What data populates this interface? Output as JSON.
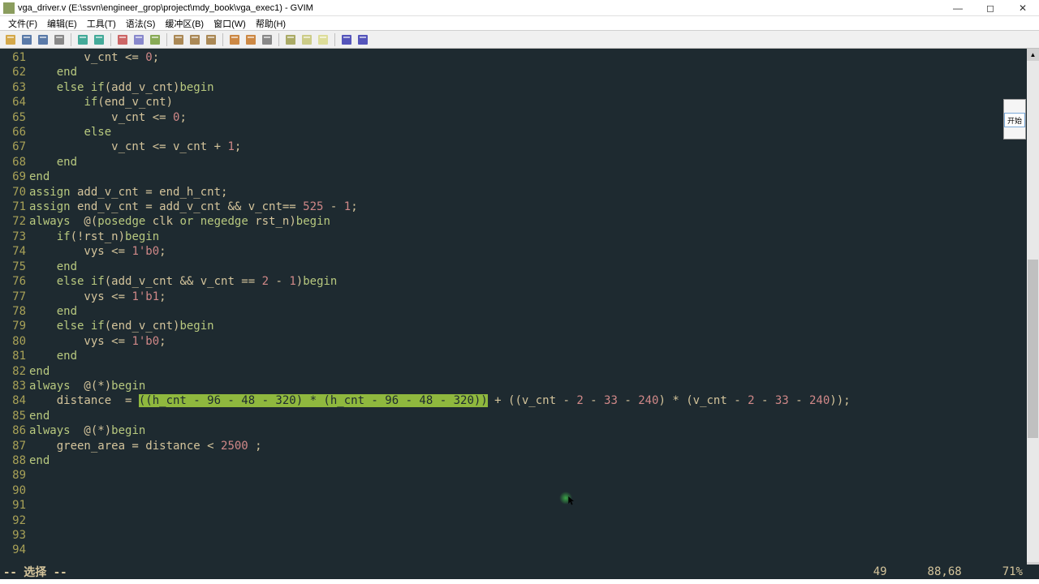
{
  "window": {
    "title": "vga_driver.v (E:\\ssvn\\engineer_grop\\project\\mdy_book\\vga_exec1) - GVIM"
  },
  "menus": [
    "文件(F)",
    "编辑(E)",
    "工具(T)",
    "语法(S)",
    "缓冲区(B)",
    "窗口(W)",
    "帮助(H)"
  ],
  "toolbar_icons": [
    "open-icon",
    "save-icon",
    "saveall-icon",
    "print-icon",
    "",
    "undo-icon",
    "redo-icon",
    "",
    "cut-icon",
    "copy-icon",
    "paste-icon",
    "",
    "find-prev-icon",
    "find-next-icon",
    "replace-icon",
    "",
    "run-icon",
    "make-icon",
    "shell-icon",
    "",
    "tag-icon",
    "tags-icon",
    "tagselect-icon",
    "",
    "help-icon",
    "findword-icon"
  ],
  "mini_window": {
    "btn": "开始"
  },
  "status": {
    "mode": "-- 选择 --",
    "col": "49",
    "pos": "88,68",
    "pct": "71%"
  },
  "first_line": 61,
  "lines": [
    {
      "n": 61,
      "segs": [
        {
          "t": "        v_cnt <= "
        },
        {
          "t": "0",
          "c": "num"
        },
        {
          "t": ";"
        }
      ]
    },
    {
      "n": 62,
      "segs": [
        {
          "t": "    "
        },
        {
          "t": "end",
          "c": "kw"
        }
      ]
    },
    {
      "n": 63,
      "segs": [
        {
          "t": "    "
        },
        {
          "t": "else if",
          "c": "kw"
        },
        {
          "t": "(add_v_cnt)"
        },
        {
          "t": "begin",
          "c": "kw"
        }
      ]
    },
    {
      "n": 64,
      "segs": [
        {
          "t": "        "
        },
        {
          "t": "if",
          "c": "kw"
        },
        {
          "t": "(end_v_cnt)"
        }
      ]
    },
    {
      "n": 65,
      "segs": [
        {
          "t": "            v_cnt <= "
        },
        {
          "t": "0",
          "c": "num"
        },
        {
          "t": ";"
        }
      ]
    },
    {
      "n": 66,
      "segs": [
        {
          "t": "        "
        },
        {
          "t": "else",
          "c": "kw"
        }
      ]
    },
    {
      "n": 67,
      "segs": [
        {
          "t": "            v_cnt <= v_cnt + "
        },
        {
          "t": "1",
          "c": "num"
        },
        {
          "t": ";"
        }
      ]
    },
    {
      "n": 68,
      "segs": [
        {
          "t": "    "
        },
        {
          "t": "end",
          "c": "kw"
        }
      ]
    },
    {
      "n": 69,
      "segs": [
        {
          "t": "end",
          "c": "kw"
        }
      ]
    },
    {
      "n": 70,
      "segs": [
        {
          "t": "assign",
          "c": "kw"
        },
        {
          "t": " add_v_cnt = end_h_cnt;"
        }
      ]
    },
    {
      "n": 71,
      "segs": [
        {
          "t": "assign",
          "c": "kw"
        },
        {
          "t": " end_v_cnt = add_v_cnt && v_cnt== "
        },
        {
          "t": "525",
          "c": "num"
        },
        {
          "t": " - "
        },
        {
          "t": "1",
          "c": "num"
        },
        {
          "t": ";"
        }
      ]
    },
    {
      "n": 72,
      "segs": [
        {
          "t": ""
        }
      ]
    },
    {
      "n": 73,
      "segs": [
        {
          "t": ""
        }
      ]
    },
    {
      "n": 74,
      "segs": [
        {
          "t": "always",
          "c": "kw"
        },
        {
          "t": "  @("
        },
        {
          "t": "posedge",
          "c": "kw"
        },
        {
          "t": " clk "
        },
        {
          "t": "or negedge",
          "c": "kw"
        },
        {
          "t": " rst_n)"
        },
        {
          "t": "begin",
          "c": "kw"
        }
      ]
    },
    {
      "n": 75,
      "segs": [
        {
          "t": "    "
        },
        {
          "t": "if",
          "c": "kw"
        },
        {
          "t": "(!rst_n)"
        },
        {
          "t": "begin",
          "c": "kw"
        }
      ]
    },
    {
      "n": 76,
      "segs": [
        {
          "t": "        vys <= "
        },
        {
          "t": "1'b0",
          "c": "num"
        },
        {
          "t": ";"
        }
      ]
    },
    {
      "n": 77,
      "segs": [
        {
          "t": "    "
        },
        {
          "t": "end",
          "c": "kw"
        }
      ]
    },
    {
      "n": 78,
      "segs": [
        {
          "t": "    "
        },
        {
          "t": "else if",
          "c": "kw"
        },
        {
          "t": "(add_v_cnt && v_cnt == "
        },
        {
          "t": "2",
          "c": "num"
        },
        {
          "t": " - "
        },
        {
          "t": "1",
          "c": "num"
        },
        {
          "t": ")"
        },
        {
          "t": "begin",
          "c": "kw"
        }
      ]
    },
    {
      "n": 79,
      "segs": [
        {
          "t": "        vys <= "
        },
        {
          "t": "1'b1",
          "c": "num"
        },
        {
          "t": ";"
        }
      ]
    },
    {
      "n": 80,
      "segs": [
        {
          "t": "    "
        },
        {
          "t": "end",
          "c": "kw"
        }
      ]
    },
    {
      "n": 81,
      "segs": [
        {
          "t": "    "
        },
        {
          "t": "else if",
          "c": "kw"
        },
        {
          "t": "(end_v_cnt)"
        },
        {
          "t": "begin",
          "c": "kw"
        }
      ]
    },
    {
      "n": 82,
      "segs": [
        {
          "t": "        vys <= "
        },
        {
          "t": "1'b0",
          "c": "num"
        },
        {
          "t": ";"
        }
      ]
    },
    {
      "n": 83,
      "segs": [
        {
          "t": "    "
        },
        {
          "t": "end",
          "c": "kw"
        }
      ]
    },
    {
      "n": 84,
      "segs": [
        {
          "t": "end",
          "c": "kw"
        }
      ]
    },
    {
      "n": 85,
      "segs": [
        {
          "t": ""
        }
      ]
    },
    {
      "n": 86,
      "segs": [
        {
          "t": ""
        }
      ]
    },
    {
      "n": 87,
      "segs": [
        {
          "t": "always",
          "c": "kw"
        },
        {
          "t": "  @(*)"
        },
        {
          "t": "begin",
          "c": "kw"
        }
      ]
    },
    {
      "n": 88,
      "segs": [
        {
          "t": "    distance  = "
        },
        {
          "t": "((h_cnt - 96 - 48 - 320) * (h_cnt - 96 - 48 - 320))",
          "c": "selection"
        },
        {
          "t": " + ((v_cnt - "
        },
        {
          "t": "2",
          "c": "num"
        },
        {
          "t": " - "
        },
        {
          "t": "33",
          "c": "num"
        },
        {
          "t": " - "
        },
        {
          "t": "240",
          "c": "num"
        },
        {
          "t": ") * (v_cnt - "
        },
        {
          "t": "2",
          "c": "num"
        },
        {
          "t": " - "
        },
        {
          "t": "33",
          "c": "num"
        },
        {
          "t": " - "
        },
        {
          "t": "240",
          "c": "num"
        },
        {
          "t": "));"
        }
      ]
    },
    {
      "n": 89,
      "segs": [
        {
          "t": "end",
          "c": "kw"
        }
      ]
    },
    {
      "n": 90,
      "segs": [
        {
          "t": ""
        }
      ]
    },
    {
      "n": 91,
      "segs": [
        {
          "t": ""
        }
      ]
    },
    {
      "n": 92,
      "segs": [
        {
          "t": "always",
          "c": "kw"
        },
        {
          "t": "  @(*)"
        },
        {
          "t": "begin",
          "c": "kw"
        }
      ]
    },
    {
      "n": 93,
      "segs": [
        {
          "t": "    green_area = distance < "
        },
        {
          "t": "2500",
          "c": "num"
        },
        {
          "t": " ;"
        }
      ]
    },
    {
      "n": 94,
      "segs": [
        {
          "t": "end",
          "c": "kw"
        }
      ]
    }
  ]
}
